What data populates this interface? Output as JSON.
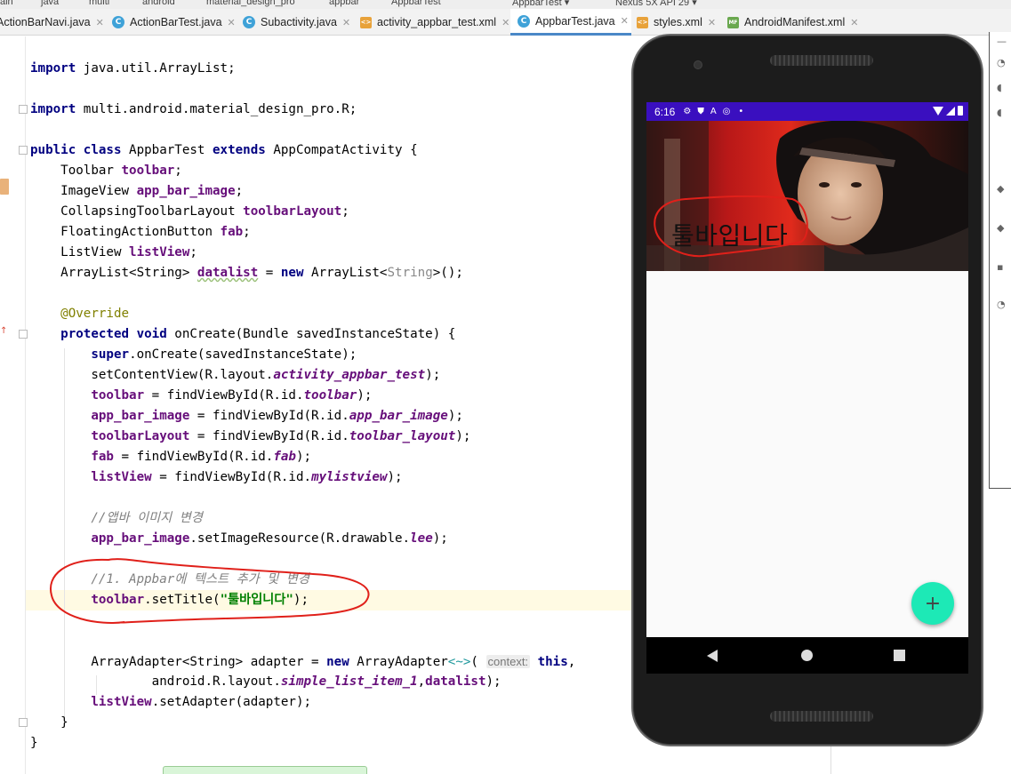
{
  "breadcrumbs": [
    {
      "label": "ain"
    },
    {
      "label": "java"
    },
    {
      "label": "multi"
    },
    {
      "label": "android"
    },
    {
      "label": "material_design_pro"
    },
    {
      "label": "appbar"
    },
    {
      "label": "AppbarTest"
    },
    {
      "label": "AppbarTest ▾"
    },
    {
      "label": "Nexus 5X API 29 ▾"
    }
  ],
  "tabs": [
    {
      "label": "ActionBarNavi.java",
      "icon": "C",
      "kind": "java"
    },
    {
      "label": "ActionBarTest.java",
      "icon": "C",
      "kind": "java"
    },
    {
      "label": "Subactivity.java",
      "icon": "C",
      "kind": "java"
    },
    {
      "label": "activity_appbar_test.xml",
      "icon": "<>",
      "kind": "xml"
    },
    {
      "label": "AppbarTest.java",
      "icon": "C",
      "kind": "java",
      "active": true
    },
    {
      "label": "styles.xml",
      "icon": "<>",
      "kind": "xml"
    },
    {
      "label": "AndroidManifest.xml",
      "icon": "MF",
      "kind": "manifest"
    }
  ],
  "code": {
    "import_arraylist": "import java.util.ArrayList;",
    "import_r": "import multi.android.material_design_pro.R;",
    "comment_image": "//앱바 이미지 변경",
    "comment_title": "//1. Appbar에 텍스트 추가 및 변경",
    "title_string": "\"툴바입니다\"",
    "param_hint": "context:"
  },
  "phone": {
    "status_time": "6:16",
    "status_icons": [
      "gear-icon",
      "shield-icon",
      "a-icon",
      "sync-icon",
      "dot-icon"
    ],
    "appbar_title": "툴바입니다",
    "fab_symbol": "+",
    "colors": {
      "status_bar": "#3a0fbf",
      "fab": "#1de9b6",
      "annotation_ink": "#e0201a"
    }
  }
}
